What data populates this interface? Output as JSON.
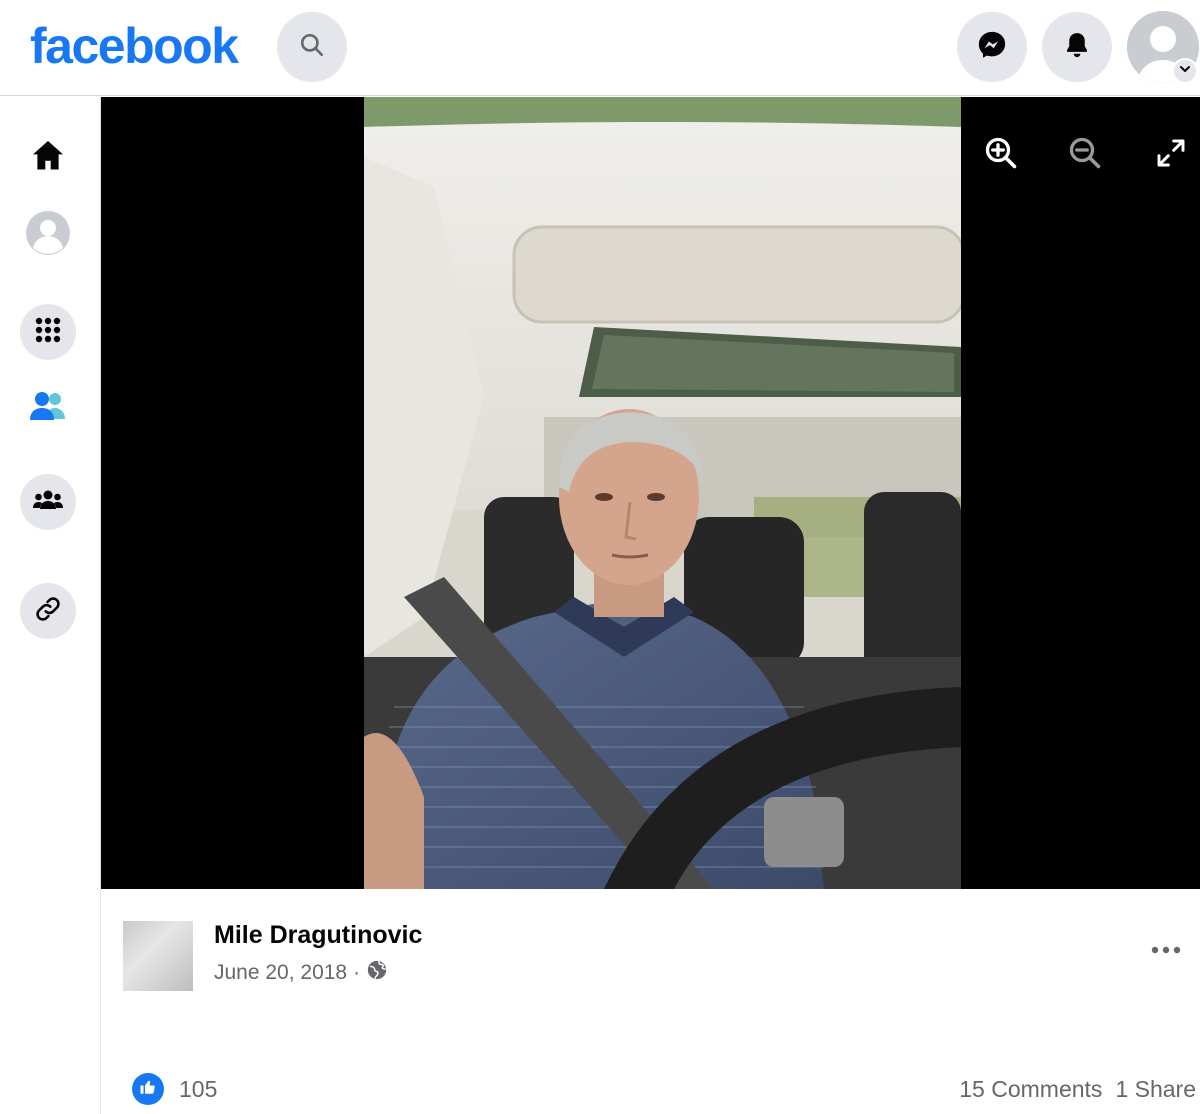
{
  "header": {
    "logo": "facebook"
  },
  "colors": {
    "brand": "#1877f2",
    "icon_bg": "#e4e6eb",
    "secondary_text": "#65676b"
  },
  "nav_icons": {
    "search": "search-icon",
    "messenger": "messenger-icon",
    "notifications": "bell-icon",
    "account": "avatar-icon"
  },
  "sidebar": {
    "items": [
      {
        "icon": "home-icon"
      },
      {
        "icon": "profile-icon"
      },
      {
        "icon": "apps-grid-icon"
      },
      {
        "icon": "friends-icon"
      },
      {
        "icon": "groups-icon"
      },
      {
        "icon": "link-icon"
      }
    ]
  },
  "viewer": {
    "tools": [
      "zoom-in-icon",
      "zoom-out-icon",
      "fullscreen-icon"
    ]
  },
  "post": {
    "author": "Mile Dragutinovic",
    "date": "June 20, 2018",
    "separator": "·",
    "audience_icon": "globe-icon",
    "likes": "105",
    "comments": "15 Comments",
    "shares": "1 Share"
  }
}
